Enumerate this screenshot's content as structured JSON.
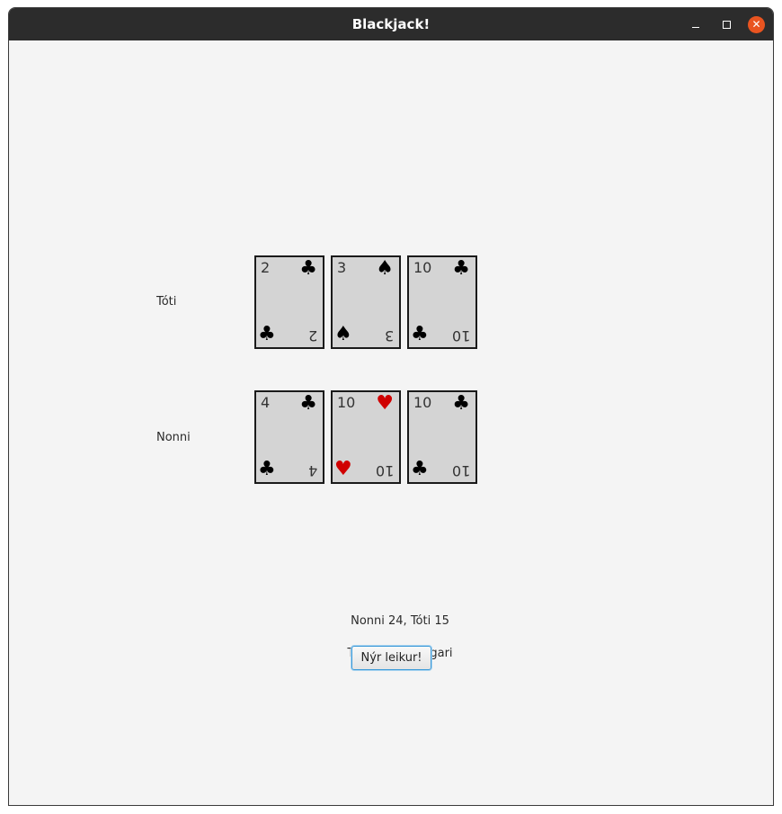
{
  "window": {
    "title": "Blackjack!",
    "close_glyph": "✕"
  },
  "players": [
    {
      "name": "Tóti",
      "cards": [
        {
          "rank": "2",
          "suit": "♣",
          "color": "black"
        },
        {
          "rank": "3",
          "suit": "♠",
          "color": "black"
        },
        {
          "rank": "10",
          "suit": "♣",
          "color": "black"
        }
      ]
    },
    {
      "name": "Nonni",
      "cards": [
        {
          "rank": "4",
          "suit": "♣",
          "color": "black"
        },
        {
          "rank": "10",
          "suit": "♥",
          "color": "red"
        },
        {
          "rank": "10",
          "suit": "♣",
          "color": "black"
        }
      ]
    }
  ],
  "score_text": "Nonni 24, Tóti 15",
  "result_text": "Tóti er sigurvegari",
  "new_game_label": "Nýr leikur!",
  "colors": {
    "red_suit": "#d00000",
    "card_bg": "#d4d4d4",
    "close_button": "#e95420"
  }
}
